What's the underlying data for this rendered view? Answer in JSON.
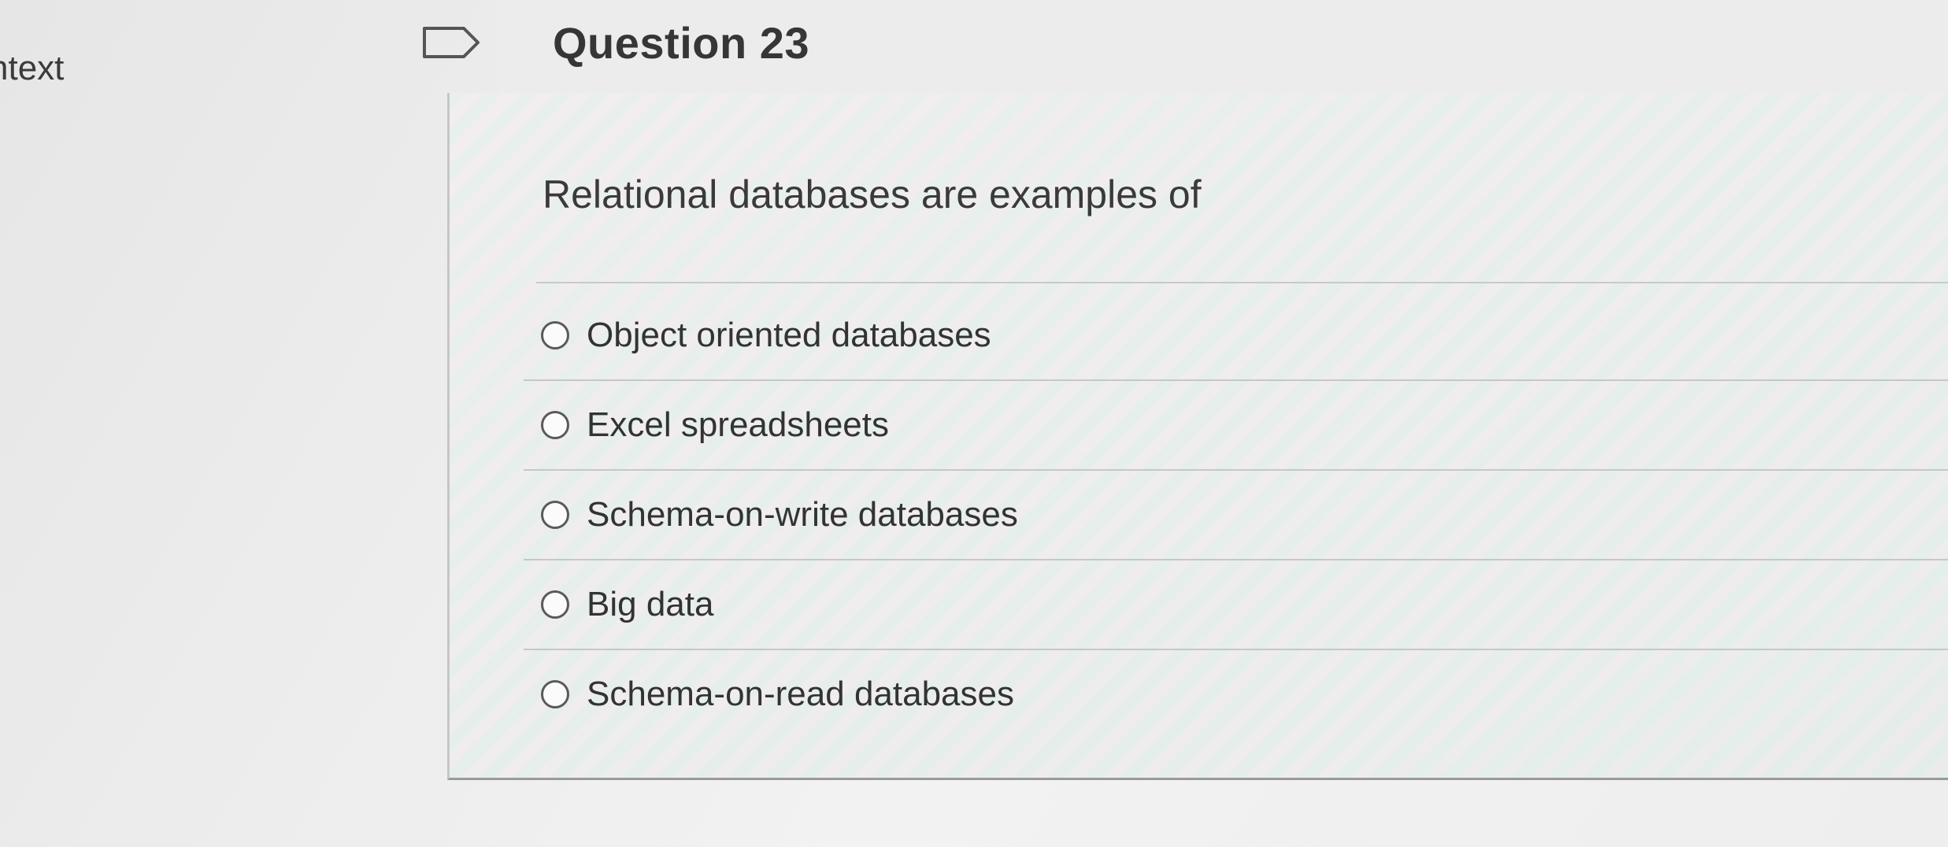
{
  "side": {
    "label": "ntext"
  },
  "header": {
    "title": "Question 23",
    "flag_icon": "flag-outline-icon"
  },
  "question": {
    "text": "Relational databases are examples of",
    "options": [
      {
        "label": "Object oriented databases",
        "selected": false
      },
      {
        "label": "Excel spreadsheets",
        "selected": false
      },
      {
        "label": "Schema-on-write databases",
        "selected": false
      },
      {
        "label": "Big data",
        "selected": false
      },
      {
        "label": "Schema-on-read databases",
        "selected": false
      }
    ]
  },
  "colors": {
    "text": "#3a3a3a",
    "divider": "#c7c7c7",
    "radio_border": "#5a5a5a"
  }
}
